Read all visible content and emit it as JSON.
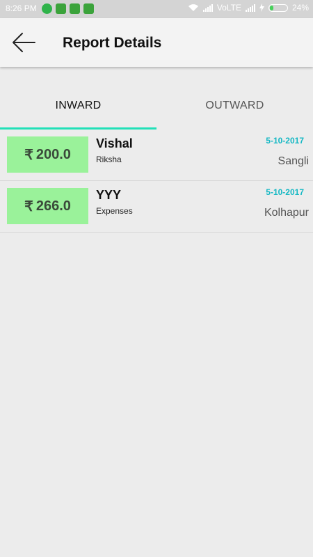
{
  "status_bar": {
    "time": "8:26 PM",
    "network": "VoLTE",
    "battery_percent": "24%",
    "battery_level": 0.24,
    "app_icons": [
      "whatsapp-icon",
      "alarm-icon",
      "android-icon",
      "alarm-icon"
    ]
  },
  "header": {
    "title": "Report Details",
    "back_icon": "arrow-left-icon"
  },
  "tabs": [
    {
      "label": "INWARD",
      "selected": true
    },
    {
      "label": "OUTWARD",
      "selected": false
    }
  ],
  "colors": {
    "accent": "#22e0b8",
    "amount_bg": "#9af29a",
    "date_text": "#14b8c4"
  },
  "reports": [
    {
      "currency": "₹",
      "amount": "200.0",
      "name": "Vishal",
      "category": "Riksha",
      "date": "5-10-2017",
      "place": "Sangli"
    },
    {
      "currency": "₹",
      "amount": "266.0",
      "name": "YYY",
      "category": "Expenses",
      "date": "5-10-2017",
      "place": "Kolhapur"
    }
  ]
}
